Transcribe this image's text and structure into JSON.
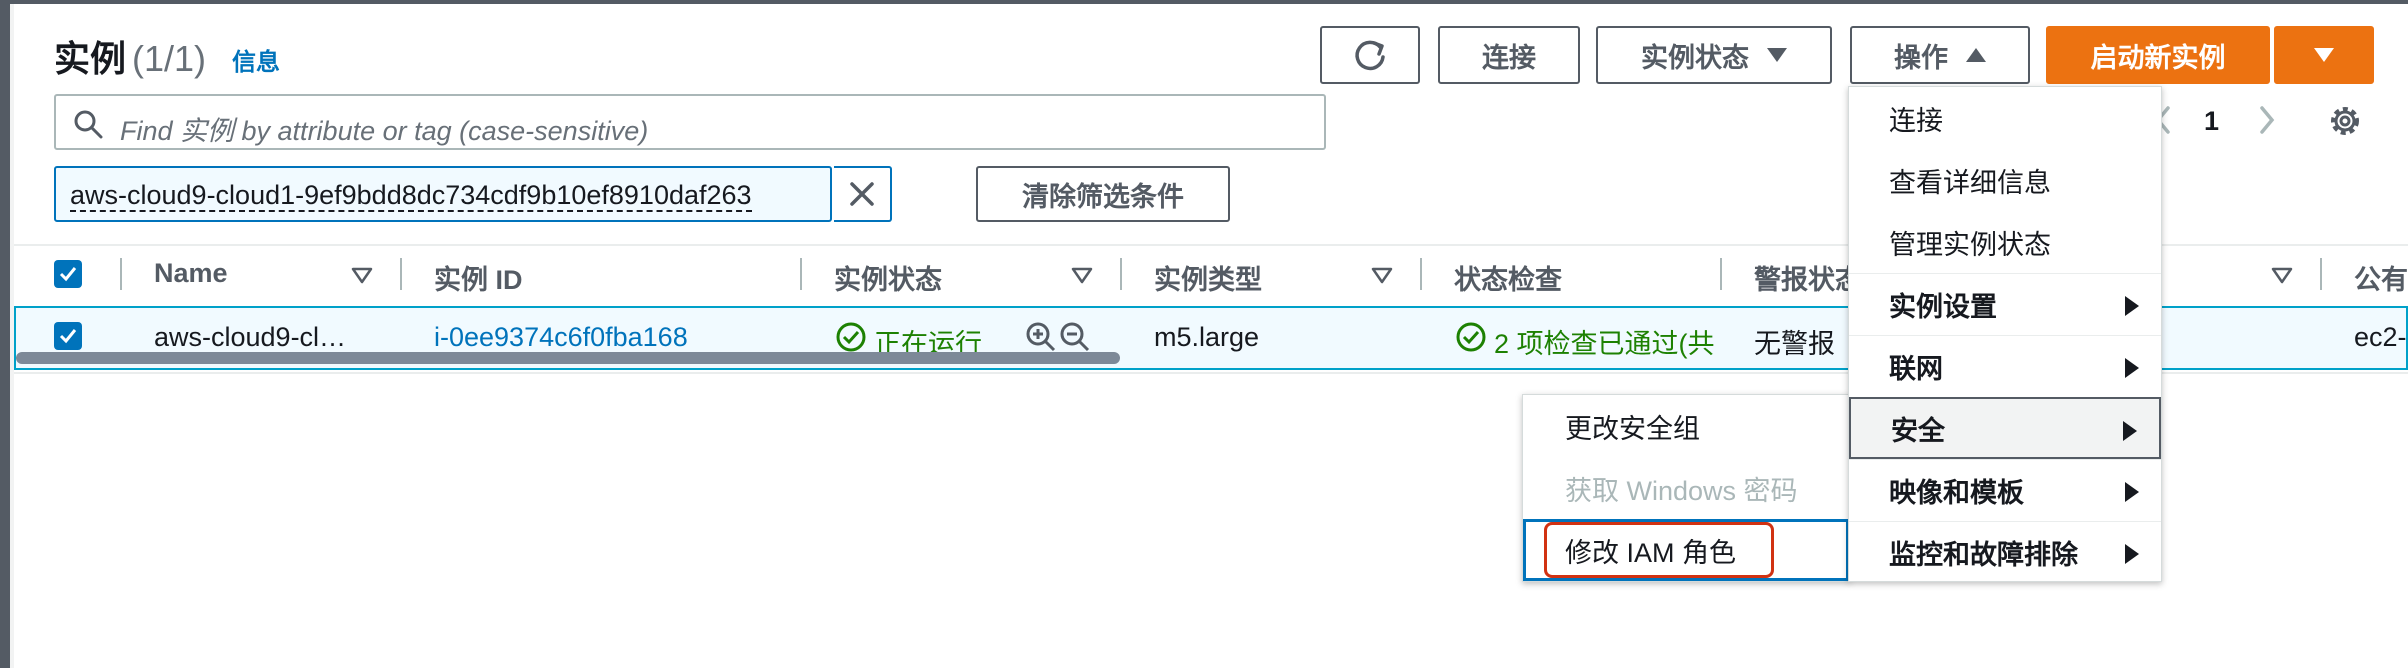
{
  "header": {
    "title": "实例",
    "count": "(1/1)",
    "info_link": "信息"
  },
  "toolbar": {
    "refresh_icon": "refresh-icon",
    "connect_label": "连接",
    "instance_state_label": "实例状态",
    "actions_label": "操作",
    "launch_label": "启动新实例"
  },
  "search": {
    "placeholder": "Find 实例 by attribute or tag (case-sensitive)"
  },
  "filter": {
    "token": "aws-cloud9-cloud1-9ef9bdd8dc734cdf9b10ef8910daf263",
    "clear_label": "清除筛选条件"
  },
  "pager": {
    "page": "1"
  },
  "table": {
    "columns": [
      "Name",
      "实例 ID",
      "实例状态",
      "实例类型",
      "状态检查",
      "警报状态",
      "公有"
    ],
    "rows": [
      {
        "name": "aws-cloud9-cl…",
        "instance_id": "i-0ee9374c6f0fba168",
        "state": "正在运行",
        "type": "m5.large",
        "status_check": "2 项检查已通过(共",
        "alarm": "无警报",
        "public": "ec2-"
      }
    ]
  },
  "actions_menu": {
    "items": [
      {
        "label": "连接",
        "bold": false,
        "submenu": false
      },
      {
        "label": "查看详细信息",
        "bold": false,
        "submenu": false
      },
      {
        "label": "管理实例状态",
        "bold": false,
        "submenu": false
      },
      {
        "label": "实例设置",
        "bold": true,
        "submenu": true
      },
      {
        "label": "联网",
        "bold": true,
        "submenu": true
      },
      {
        "label": "安全",
        "bold": true,
        "submenu": true,
        "active": true
      },
      {
        "label": "映像和模板",
        "bold": true,
        "submenu": true
      },
      {
        "label": "监控和故障排除",
        "bold": true,
        "submenu": true
      }
    ]
  },
  "security_submenu": {
    "items": [
      {
        "label": "更改安全组",
        "disabled": false
      },
      {
        "label": "获取 Windows 密码",
        "disabled": true
      },
      {
        "label": "修改 IAM 角色",
        "disabled": false,
        "highlighted": true
      }
    ]
  },
  "colors": {
    "accent": "#0073bb",
    "primary": "#ec7211",
    "success": "#1d8102",
    "highlight": "#d13212"
  }
}
